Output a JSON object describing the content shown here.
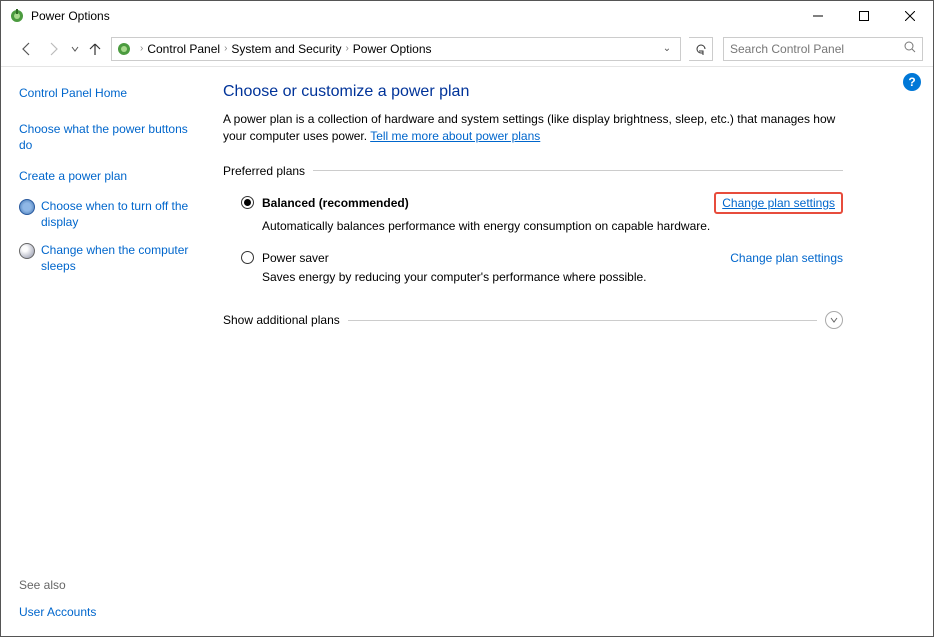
{
  "window": {
    "title": "Power Options"
  },
  "breadcrumb": {
    "items": [
      "Control Panel",
      "System and Security",
      "Power Options"
    ]
  },
  "search": {
    "placeholder": "Search Control Panel"
  },
  "sidebar": {
    "home": "Control Panel Home",
    "links": [
      "Choose what the power buttons do",
      "Create a power plan",
      "Choose when to turn off the display",
      "Change when the computer sleeps"
    ],
    "see_also_label": "See also",
    "see_also_links": [
      "User Accounts"
    ]
  },
  "content": {
    "heading": "Choose or customize a power plan",
    "intro_text": "A power plan is a collection of hardware and system settings (like display brightness, sleep, etc.) that manages how your computer uses power. ",
    "intro_link": "Tell me more about power plans",
    "preferred_label": "Preferred plans",
    "plans": [
      {
        "name": "Balanced (recommended)",
        "desc": "Automatically balances performance with energy consumption on capable hardware.",
        "change": "Change plan settings",
        "selected": true,
        "highlighted": true
      },
      {
        "name": "Power saver",
        "desc": "Saves energy by reducing your computer's performance where possible.",
        "change": "Change plan settings",
        "selected": false,
        "highlighted": false
      }
    ],
    "expand_label": "Show additional plans"
  }
}
